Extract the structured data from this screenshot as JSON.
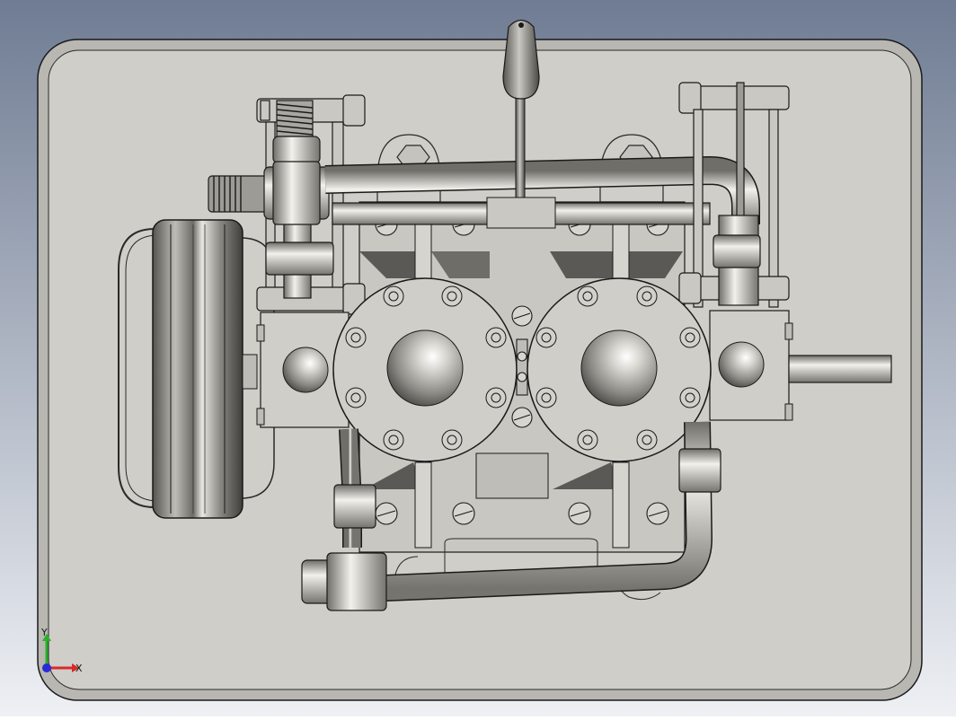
{
  "viewport": {
    "background_top": "#6f7c93",
    "background_bottom": "#e9ecf2"
  },
  "model": {
    "plate_color": "#cfcec8",
    "metal_color": "#bdbcb6",
    "outline_color": "#1a1a1a"
  },
  "triad": {
    "x_label": "X",
    "y_label": "Y",
    "z_color": "#2a2ad8",
    "x_color": "#d82a2a",
    "y_color": "#2ab02a"
  }
}
